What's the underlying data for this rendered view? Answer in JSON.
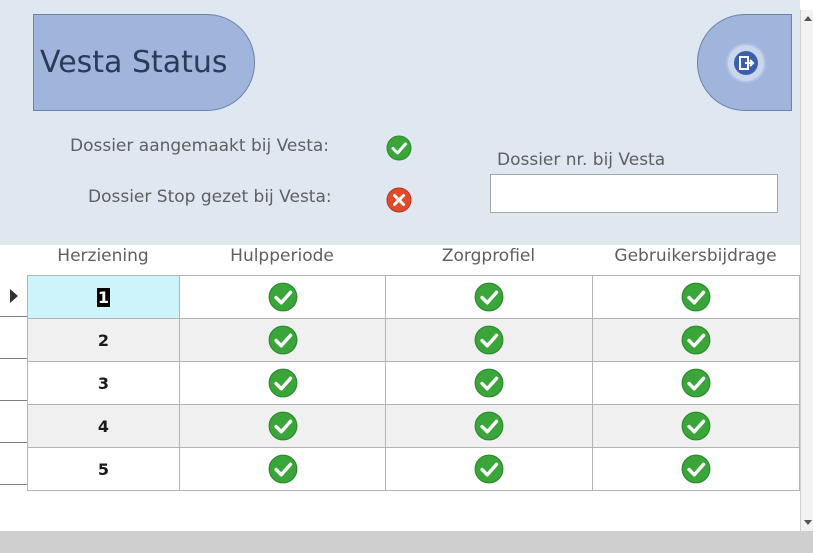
{
  "form": {
    "title": "Vesta Status",
    "exit_icon": "exit-icon"
  },
  "status": {
    "created_label": "Dossier aangemaakt bij Vesta:",
    "created_icon": "check-icon",
    "stopped_label": "Dossier Stop gezet bij Vesta:",
    "stopped_icon": "error-icon",
    "dossier_nr_label": "Dossier nr. bij Vesta",
    "dossier_nr_value": ""
  },
  "grid": {
    "columns": [
      "Herziening",
      "Hulpperiode",
      "Zorgprofiel",
      "Gebruikersbijdrage"
    ],
    "rows": [
      {
        "herziening": "1",
        "hulpperiode": "check-icon",
        "zorgprofiel": "check-icon",
        "gebruikersbijdrage": "check-icon"
      },
      {
        "herziening": "2",
        "hulpperiode": "check-icon",
        "zorgprofiel": "check-icon",
        "gebruikersbijdrage": "check-icon"
      },
      {
        "herziening": "3",
        "hulpperiode": "check-icon",
        "zorgprofiel": "check-icon",
        "gebruikersbijdrage": "check-icon"
      },
      {
        "herziening": "4",
        "hulpperiode": "check-icon",
        "zorgprofiel": "check-icon",
        "gebruikersbijdrage": "check-icon"
      },
      {
        "herziening": "5",
        "hulpperiode": "check-icon",
        "zorgprofiel": "check-icon",
        "gebruikersbijdrage": "check-icon"
      }
    ],
    "selected_row": 1
  },
  "colors": {
    "header_bg": "#dfe7f1",
    "title_bg": "#9fb5db",
    "check_green": "#3aa63a",
    "error_red": "#e04a2a",
    "selected_cell": "#cdf3fb"
  }
}
